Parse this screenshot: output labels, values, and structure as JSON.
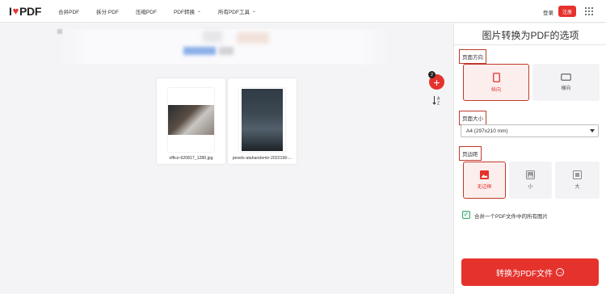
{
  "header": {
    "logo_left": "I",
    "logo_right": "PDF",
    "nav": [
      {
        "label": "合并PDF",
        "has_chevron": false
      },
      {
        "label": "拆分 PDF",
        "has_chevron": false
      },
      {
        "label": "压缩PDF",
        "has_chevron": false
      },
      {
        "label": "PDF转换",
        "has_chevron": true
      },
      {
        "label": "所有PDF工具",
        "has_chevron": true
      }
    ],
    "login_label": "登录",
    "register_label": "注册"
  },
  "workspace": {
    "files": [
      {
        "name": "office-620817_1280.jpg"
      },
      {
        "name": "pexels-atahandemir-2022196-..."
      }
    ],
    "file_count": "2"
  },
  "panel": {
    "title": "图片转换为PDF的选项",
    "orientation": {
      "label": "页面方向",
      "options": [
        "纵向",
        "横向"
      ],
      "selected": "纵向"
    },
    "page_size": {
      "label": "页面大小",
      "value": "A4 (297x210 mm)"
    },
    "margin": {
      "label": "页边距",
      "options": [
        "无边框",
        "小",
        "大"
      ],
      "selected": "无边框"
    },
    "merge_checkbox": {
      "label": "合并一个PDF文件中的所有图片",
      "checked": true
    },
    "convert_label": "转换为PDF文件"
  },
  "colors": {
    "brand": "#e5322d",
    "highlight_border": "#c0392b",
    "checkbox": "#3aa76d"
  }
}
